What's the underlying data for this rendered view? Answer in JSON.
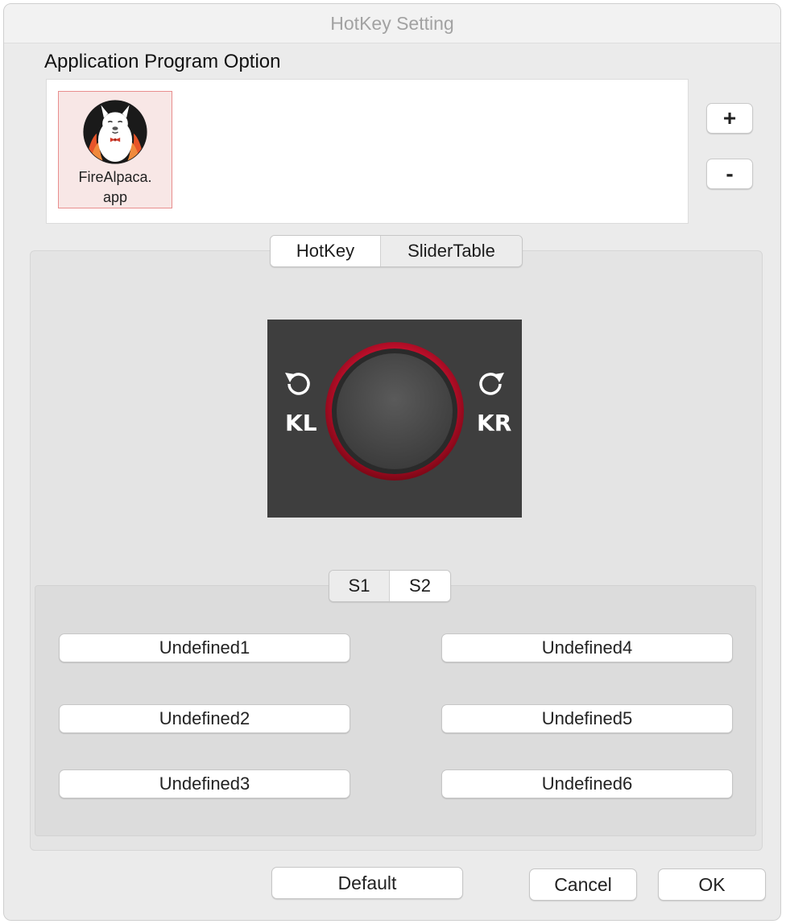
{
  "window": {
    "title": "HotKey Setting"
  },
  "app_option": {
    "label": "Application Program Option",
    "apps": [
      {
        "name_line1": "FireAlpaca.",
        "name_line2": "app",
        "icon": "firealpaca-app-icon"
      }
    ],
    "add_label": "+",
    "remove_label": "-"
  },
  "tabs": {
    "items": [
      "HotKey",
      "SliderTable"
    ],
    "selected": "HotKey"
  },
  "knob": {
    "left_label": "KL",
    "right_label": "KR",
    "left_icon": "rotate-ccw-icon",
    "right_icon": "rotate-cw-icon",
    "ring_color": "#c8102e",
    "panel_color": "#3e3e3e"
  },
  "sub_tabs": {
    "items": [
      "S1",
      "S2"
    ],
    "selected": "S2"
  },
  "buttons": {
    "left": [
      "Undefined1",
      "Undefined2",
      "Undefined3"
    ],
    "right": [
      "Undefined4",
      "Undefined5",
      "Undefined6"
    ]
  },
  "footer": {
    "default_label": "Default",
    "cancel_label": "Cancel",
    "ok_label": "OK"
  }
}
